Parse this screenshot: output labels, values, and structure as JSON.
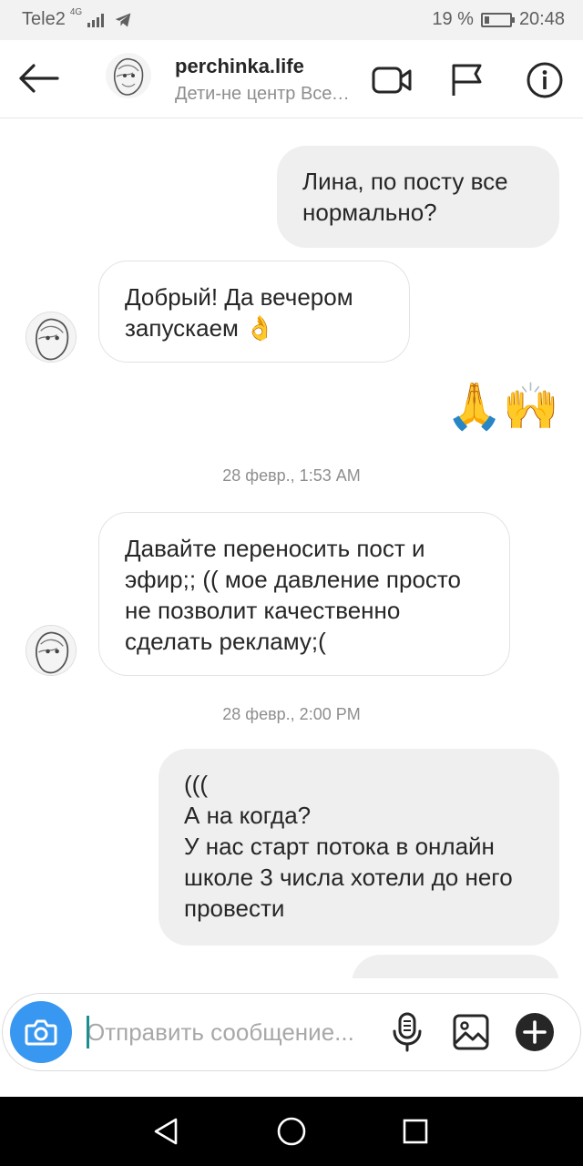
{
  "status_bar": {
    "carrier": "Tele2",
    "network": "4G",
    "battery_percent": "19 %",
    "battery_level": 0.19,
    "time": "20:48"
  },
  "header": {
    "title": "perchinka.life",
    "subtitle": "Дети-не центр Вселенной",
    "icons": [
      "back-arrow-icon",
      "video-call-icon",
      "flag-icon",
      "info-icon"
    ]
  },
  "messages": [
    {
      "id": "m1",
      "direction": "outgoing",
      "text": "Лина, по посту все нормально?"
    },
    {
      "id": "m2",
      "direction": "incoming",
      "text": "Добрый! Да вечером запускаем 👌"
    },
    {
      "id": "m3",
      "direction": "outgoing",
      "text": "🙏🙌"
    },
    {
      "id": "m4",
      "direction": "incoming",
      "text": "Давайте переносить пост и эфир;; (( мое давление просто не позволит качественно сделать рекламу;("
    },
    {
      "id": "m5",
      "direction": "outgoing",
      "text": "(((\nА на когда?\nУ нас старт потока в онлайн школе 3 числа хотели до него провести"
    }
  ],
  "timestamps": {
    "t1": "28 февр., 1:53 AM",
    "t2": "28 февр., 2:00 PM"
  },
  "composer": {
    "placeholder": "Отправить сообщение...",
    "icons": [
      "camera-icon",
      "microphone-icon",
      "gallery-icon",
      "add-icon"
    ]
  },
  "colors": {
    "accent": "#3897f0",
    "incoming_border": "#e3e3e3",
    "outgoing_bubble": "#efefef",
    "timestamp": "#8e8e8e"
  }
}
